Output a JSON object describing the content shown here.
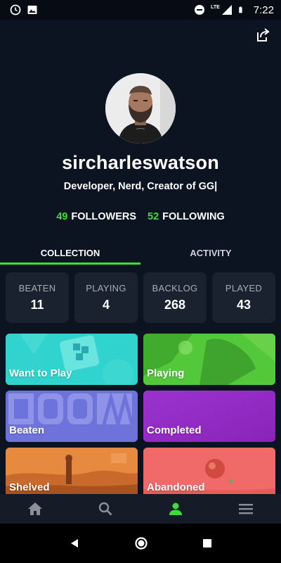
{
  "status_bar": {
    "time": "7:22",
    "network": "LTE"
  },
  "profile": {
    "username": "sircharleswatson",
    "bio": "Developer, Nerd, Creator of GG|",
    "followers_count": "49",
    "followers_label": "FOLLOWERS",
    "following_count": "52",
    "following_label": "FOLLOWING"
  },
  "tabs": [
    {
      "label": "COLLECTION",
      "active": true
    },
    {
      "label": "ACTIVITY",
      "active": false
    }
  ],
  "stats": [
    {
      "label": "BEATEN",
      "value": "11"
    },
    {
      "label": "PLAYING",
      "value": "4"
    },
    {
      "label": "BACKLOG",
      "value": "268"
    },
    {
      "label": "PLAYED",
      "value": "43"
    }
  ],
  "collections": [
    {
      "label": "Want to Play",
      "color": "#2fd4cf"
    },
    {
      "label": "Playing",
      "color": "#4fcf3c"
    },
    {
      "label": "Beaten",
      "color": "#6f73dd"
    },
    {
      "label": "Completed",
      "color": "#9a2bc9"
    },
    {
      "label": "Shelved",
      "color": "#e6833b"
    },
    {
      "label": "Abandoned",
      "color": "#ef6565"
    }
  ],
  "bottom_nav": [
    {
      "icon": "home-icon",
      "active": false
    },
    {
      "icon": "search-icon",
      "active": false
    },
    {
      "icon": "profile-icon",
      "active": true
    },
    {
      "icon": "menu-icon",
      "active": false
    }
  ],
  "colors": {
    "accent": "#3ddc3d",
    "background": "#0d1421",
    "card": "#1a2230"
  }
}
